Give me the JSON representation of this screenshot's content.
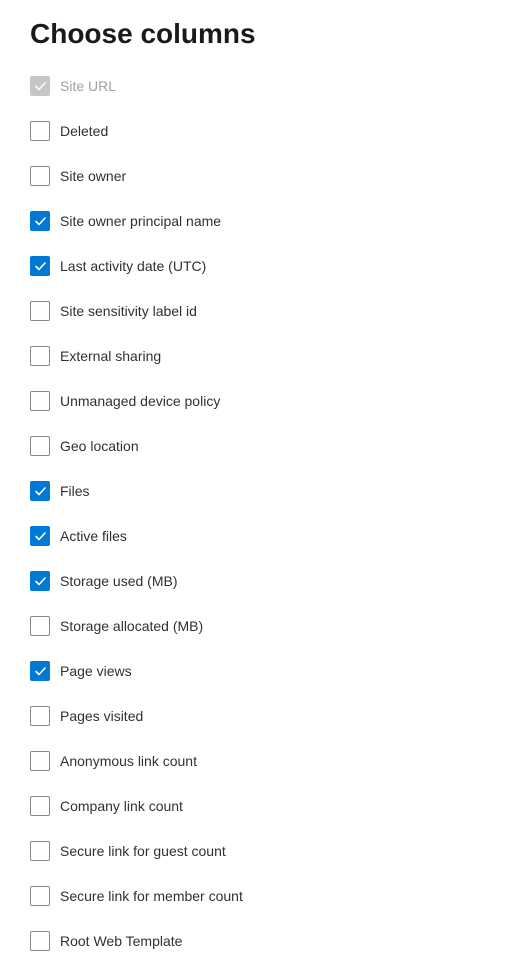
{
  "title": "Choose columns",
  "columns": [
    {
      "id": "site-url",
      "label": "Site URL",
      "checked": true,
      "disabled": true
    },
    {
      "id": "deleted",
      "label": "Deleted",
      "checked": false,
      "disabled": false
    },
    {
      "id": "site-owner",
      "label": "Site owner",
      "checked": false,
      "disabled": false
    },
    {
      "id": "site-owner-principal-name",
      "label": "Site owner principal name",
      "checked": true,
      "disabled": false
    },
    {
      "id": "last-activity-date-utc",
      "label": "Last activity date (UTC)",
      "checked": true,
      "disabled": false
    },
    {
      "id": "site-sensitivity-label-id",
      "label": "Site sensitivity label id",
      "checked": false,
      "disabled": false
    },
    {
      "id": "external-sharing",
      "label": "External sharing",
      "checked": false,
      "disabled": false
    },
    {
      "id": "unmanaged-device-policy",
      "label": "Unmanaged device policy",
      "checked": false,
      "disabled": false
    },
    {
      "id": "geo-location",
      "label": "Geo location",
      "checked": false,
      "disabled": false
    },
    {
      "id": "files",
      "label": "Files",
      "checked": true,
      "disabled": false
    },
    {
      "id": "active-files",
      "label": "Active files",
      "checked": true,
      "disabled": false
    },
    {
      "id": "storage-used-mb",
      "label": "Storage used (MB)",
      "checked": true,
      "disabled": false
    },
    {
      "id": "storage-allocated-mb",
      "label": "Storage allocated (MB)",
      "checked": false,
      "disabled": false
    },
    {
      "id": "page-views",
      "label": "Page views",
      "checked": true,
      "disabled": false
    },
    {
      "id": "pages-visited",
      "label": "Pages visited",
      "checked": false,
      "disabled": false
    },
    {
      "id": "anonymous-link-count",
      "label": "Anonymous link count",
      "checked": false,
      "disabled": false
    },
    {
      "id": "company-link-count",
      "label": "Company link count",
      "checked": false,
      "disabled": false
    },
    {
      "id": "secure-link-for-guest-count",
      "label": "Secure link for guest count",
      "checked": false,
      "disabled": false
    },
    {
      "id": "secure-link-for-member-count",
      "label": "Secure link for member count",
      "checked": false,
      "disabled": false
    },
    {
      "id": "root-web-template",
      "label": "Root Web Template",
      "checked": false,
      "disabled": false
    }
  ]
}
